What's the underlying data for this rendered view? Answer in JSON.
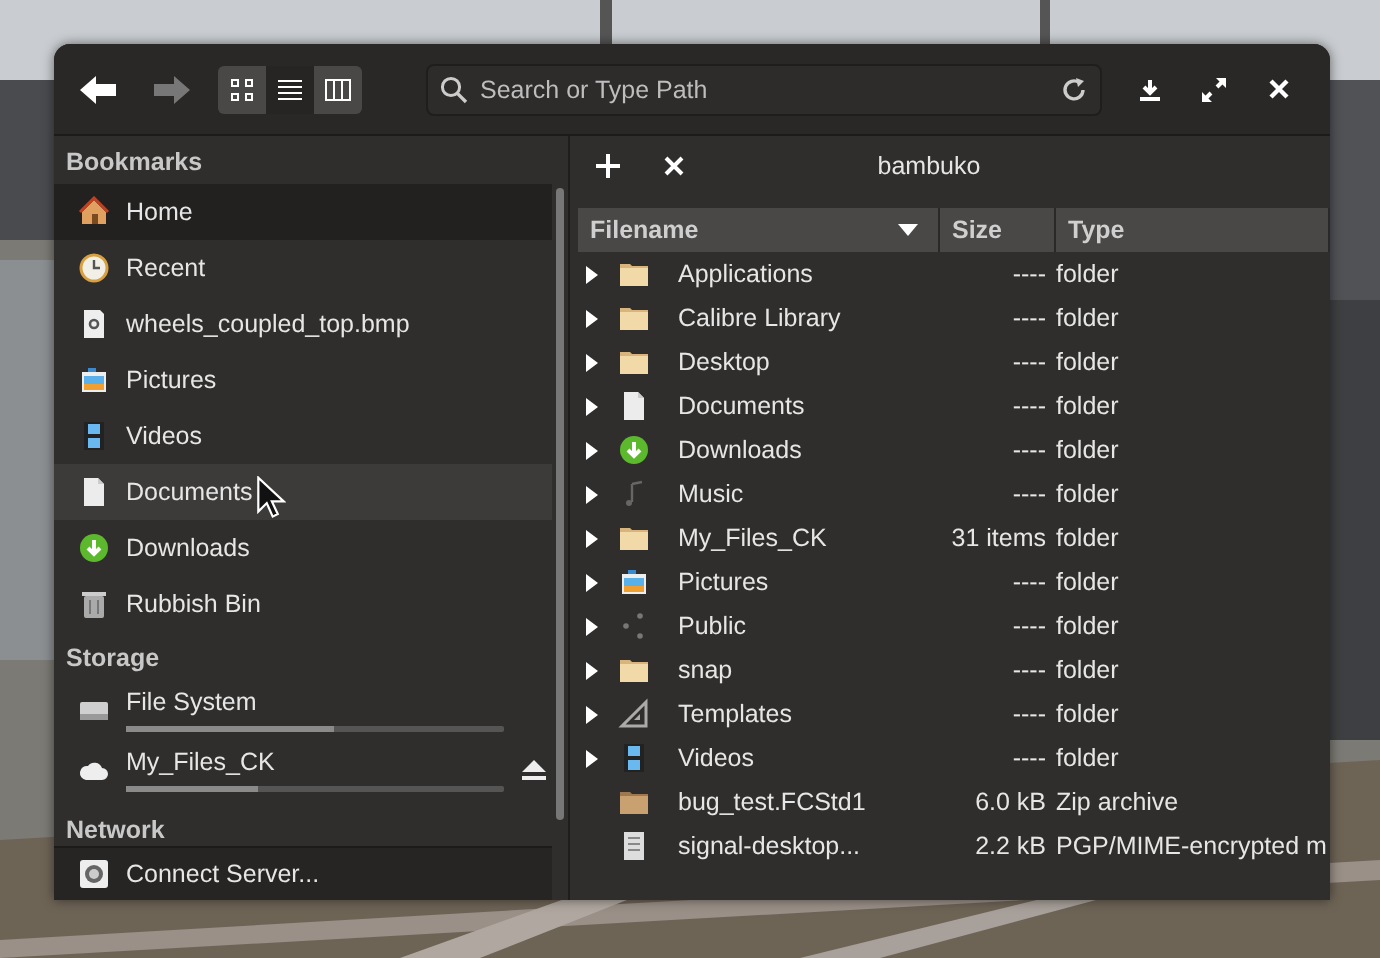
{
  "toolbar": {
    "back_enabled": true,
    "forward_enabled": false,
    "view_modes": [
      {
        "kind": "grid",
        "selected": false
      },
      {
        "kind": "list",
        "selected": true
      },
      {
        "kind": "columns",
        "selected": false
      }
    ],
    "search": {
      "placeholder": "Search or Type Path"
    }
  },
  "sidebar": {
    "bookmarks": {
      "title": "Bookmarks",
      "items": [
        {
          "label": "Home",
          "selected": true,
          "hovered": false
        },
        {
          "label": "Recent",
          "selected": false,
          "hovered": false
        },
        {
          "label": "wheels_coupled_top.bmp",
          "selected": false,
          "hovered": false
        },
        {
          "label": "Pictures",
          "selected": false,
          "hovered": false
        },
        {
          "label": "Videos",
          "selected": false,
          "hovered": false
        },
        {
          "label": "Documents",
          "selected": false,
          "hovered": true
        },
        {
          "label": "Downloads",
          "selected": false,
          "hovered": false
        },
        {
          "label": "Rubbish Bin",
          "selected": false,
          "hovered": false
        }
      ]
    },
    "storage": {
      "title": "Storage",
      "items": [
        {
          "label": "File System",
          "level": 0.55,
          "ejectable": false
        },
        {
          "label": "My_Files_CK",
          "level": 0.35,
          "ejectable": true
        }
      ]
    },
    "network": {
      "title": "Network"
    },
    "connect_button": "Connect Server..."
  },
  "tab_bar": {
    "tab_label": "bambuko"
  },
  "table": {
    "columns": [
      {
        "label": "Filename",
        "sorted": true
      },
      {
        "label": "Size",
        "sorted": false
      },
      {
        "label": "Type",
        "sorted": false
      }
    ],
    "rows": [
      {
        "name": "Applications",
        "size": "----",
        "type": "folder",
        "expandable": true
      },
      {
        "name": "Calibre Library",
        "size": "----",
        "type": "folder",
        "expandable": true
      },
      {
        "name": "Desktop",
        "size": "----",
        "type": "folder",
        "expandable": true
      },
      {
        "name": "Documents",
        "size": "----",
        "type": "folder",
        "expandable": true
      },
      {
        "name": "Downloads",
        "size": "----",
        "type": "folder",
        "expandable": true
      },
      {
        "name": "Music",
        "size": "----",
        "type": "folder",
        "expandable": true
      },
      {
        "name": "My_Files_CK",
        "size": "31 items",
        "type": "folder",
        "expandable": true
      },
      {
        "name": "Pictures",
        "size": "----",
        "type": "folder",
        "expandable": true
      },
      {
        "name": "Public",
        "size": "----",
        "type": "folder",
        "expandable": true
      },
      {
        "name": "snap",
        "size": "----",
        "type": "folder",
        "expandable": true
      },
      {
        "name": "Templates",
        "size": "----",
        "type": "folder",
        "expandable": true
      },
      {
        "name": "Videos",
        "size": "----",
        "type": "folder",
        "expandable": true
      },
      {
        "name": "bug_test.FCStd1",
        "size": "6.0 kB",
        "type": "Zip archive",
        "expandable": false
      },
      {
        "name": "signal-desktop...",
        "size": "2.2 kB",
        "type": "PGP/MIME-encrypted m",
        "expandable": false
      }
    ]
  }
}
